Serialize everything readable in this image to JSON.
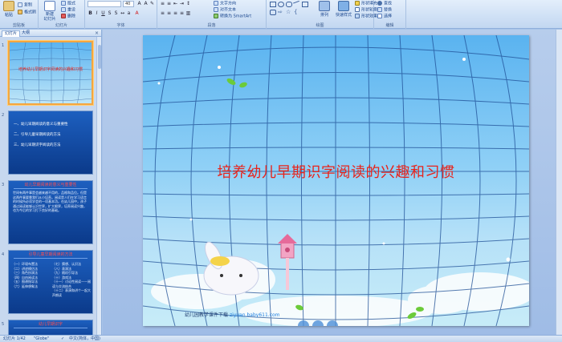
{
  "ribbon": {
    "clipboard": {
      "paste": "粘贴",
      "copy": "复制",
      "format_painter": "格式刷",
      "group": "剪贴板"
    },
    "slides": {
      "new_slide": "新建\n幻灯片",
      "layout": "版式",
      "reset": "重设",
      "delete": "删除",
      "group": "幻灯片"
    },
    "font": {
      "size": "40",
      "group": "字体"
    },
    "paragraph": {
      "text_direction": "文字方向",
      "align_text": "对齐文本",
      "smartart": "转换为 SmartArt",
      "group": "段落"
    },
    "drawing": {
      "arrange": "排列",
      "quick_styles": "快速样式",
      "fill": "形状填充",
      "outline": "形状轮廓",
      "effects": "形状效果",
      "group": "绘图"
    },
    "editing": {
      "find": "查找",
      "replace": "替换",
      "select": "选择",
      "group": "编辑"
    }
  },
  "panel": {
    "tabs": [
      "幻灯片",
      "大纲"
    ],
    "close": "×",
    "thumbs": [
      {
        "num": "1",
        "title": "培养幼儿早期识字阅读的兴趣和习惯"
      },
      {
        "num": "2",
        "lines": [
          "一、幼儿早期阅读的意义与重要性",
          "二、引导儿童早期阅读的方法",
          "三、幼儿早期识字阅读的方法"
        ]
      },
      {
        "num": "3",
        "head": "幼儿早期阅读的意义与重要性",
        "para": "世间有两件事是会越来越不用的，品格和品位。但是这两件事要靠我们从小培养。阅读是人们在学习语言的时候所必须学会的一项基本功。在幼儿园中，孩子通过阅读能够认识世界，扩大眼界，培养阅读兴趣，也为今后的学习打下良好的基础。"
      },
      {
        "num": "4",
        "head": "引导儿童早期阅读的方法",
        "left": [
          "（一）环境布置法",
          "（二）讲述模仿法",
          "（三）角色扮演法",
          "（四）自由阅读法",
          "（五）图谱指导法",
          "（六）延伸想象法"
        ],
        "right": [
          "（七）猜想、认识法",
          "（八）表演法",
          "（九）随机引导法",
          "（十）游戏法",
          "（十一）讨论性阅读——阅读与交流结合",
          "（十二）表演和讲个一起大声朗读"
        ]
      },
      {
        "num": "5",
        "head": "幼儿早期识字"
      }
    ]
  },
  "slide": {
    "title": "培养幼儿早期识字阅读的兴趣和习惯",
    "footer": "幼儿园教学课件下载",
    "url": "ziyuan.baby611.com"
  },
  "status": {
    "slide": "幻灯片 1/42",
    "theme": "\"Globe\"",
    "language": "中文(简体，中国)"
  }
}
